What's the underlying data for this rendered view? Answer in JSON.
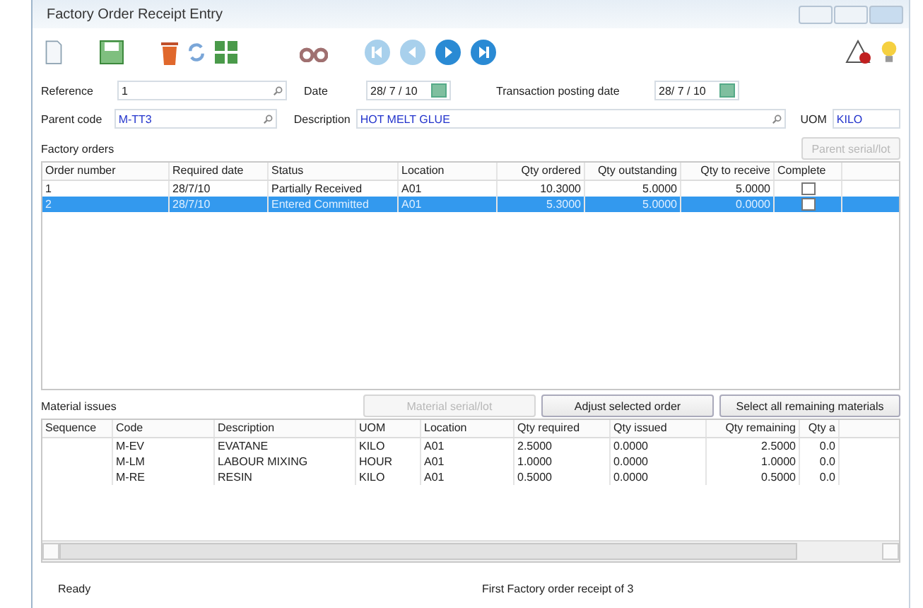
{
  "window": {
    "title": "Factory Order Receipt Entry"
  },
  "header": {
    "reference_label": "Reference",
    "reference": "1",
    "date_label": "Date",
    "date": "28/ 7 / 10",
    "posting_label": "Transaction posting date",
    "posting_date": "28/ 7 / 10",
    "parent_label": "Parent code",
    "parent_code": "M-TT3",
    "description_label": "Description",
    "description": "HOT MELT GLUE",
    "uom_label": "UOM",
    "uom": "KILO"
  },
  "factory_orders": {
    "label": "Factory orders",
    "button": {
      "label": "Parent serial/lot",
      "disabled": true
    },
    "columns": [
      "Order number",
      "Required date",
      "Status",
      "Location",
      "Qty ordered",
      "Qty outstanding",
      "Qty to receive",
      "Complete"
    ],
    "rows": [
      {
        "cells": [
          "1",
          "28/7/10",
          "Partially Received",
          "A01",
          "10.3000",
          "5.0000",
          "5.0000"
        ],
        "complete": false,
        "selected": false
      },
      {
        "cells": [
          "2",
          "28/7/10",
          "Entered Committed",
          "A01",
          "5.3000",
          "5.0000",
          "0.0000"
        ],
        "complete": false,
        "selected": true
      }
    ]
  },
  "material_issues": {
    "label": "Material issues",
    "buttons": [
      {
        "label": "Material serial/lot",
        "disabled": true
      },
      {
        "label": "Adjust selected order",
        "disabled": false
      },
      {
        "label": "Select all remaining materials",
        "disabled": false
      }
    ],
    "columns": [
      "Sequence",
      "Code",
      "Description",
      "UOM",
      "Location",
      "Qty required",
      "Qty issued",
      "Qty remaining",
      "Qty a"
    ],
    "rows": [
      [
        "",
        "M-EV",
        "EVATANE",
        "KILO",
        "A01",
        "2.5000",
        "0.0000",
        "2.5000",
        "0.0"
      ],
      [
        "",
        "M-LM",
        "LABOUR MIXING",
        "HOUR",
        "A01",
        "1.0000",
        "0.0000",
        "1.0000",
        "0.0"
      ],
      [
        "",
        "M-RE",
        "RESIN",
        "KILO",
        "A01",
        "0.5000",
        "0.0000",
        "0.5000",
        "0.0"
      ]
    ]
  },
  "status_bar": {
    "left": "Ready",
    "center": "First Factory order receipt of 3"
  }
}
